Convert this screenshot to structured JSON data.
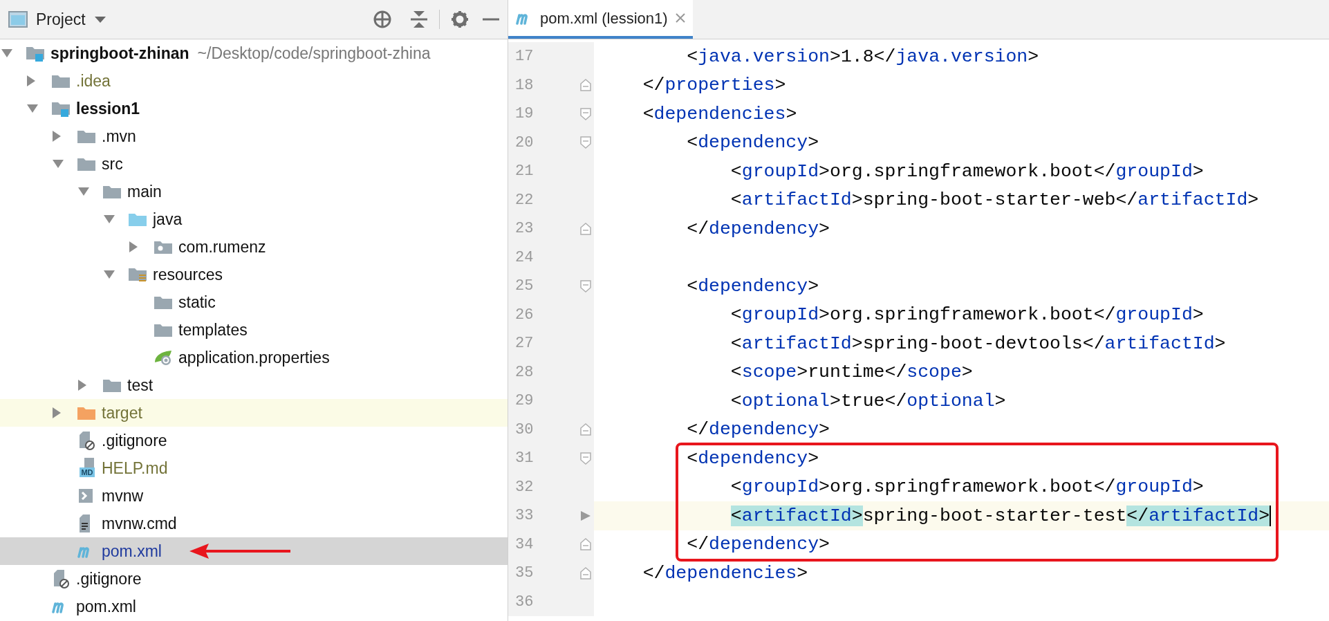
{
  "project_panel": {
    "title": "Project",
    "tree": [
      {
        "name": "springboot-zhinan",
        "path": "~/Desktop/code/springboot-zhina",
        "kind": "module",
        "expanded": true,
        "ignored": false,
        "modified": false,
        "selected": false,
        "highlighted": false,
        "arrow": false,
        "children": [
          {
            "name": ".idea",
            "kind": "folder",
            "expanded": false,
            "ignored": true,
            "modified": false,
            "selected": false,
            "highlighted": false,
            "arrow": false
          },
          {
            "name": "lession1",
            "kind": "module",
            "expanded": true,
            "ignored": false,
            "modified": false,
            "selected": false,
            "highlighted": false,
            "arrow": false,
            "children": [
              {
                "name": ".mvn",
                "kind": "folder",
                "expanded": false,
                "ignored": false,
                "modified": false,
                "selected": false,
                "highlighted": false,
                "arrow": false
              },
              {
                "name": "src",
                "kind": "folder",
                "expanded": true,
                "ignored": false,
                "modified": false,
                "selected": false,
                "highlighted": false,
                "arrow": false,
                "children": [
                  {
                    "name": "main",
                    "kind": "folder",
                    "expanded": true,
                    "ignored": false,
                    "modified": false,
                    "selected": false,
                    "highlighted": false,
                    "arrow": false,
                    "children": [
                      {
                        "name": "java",
                        "kind": "source-folder",
                        "expanded": true,
                        "ignored": false,
                        "modified": false,
                        "selected": false,
                        "highlighted": false,
                        "arrow": false,
                        "children": [
                          {
                            "name": "com.rumenz",
                            "kind": "package",
                            "expanded": false,
                            "ignored": false,
                            "modified": false,
                            "selected": false,
                            "highlighted": false,
                            "arrow": false
                          }
                        ]
                      },
                      {
                        "name": "resources",
                        "kind": "resources",
                        "expanded": true,
                        "ignored": false,
                        "modified": false,
                        "selected": false,
                        "highlighted": false,
                        "arrow": false,
                        "children": [
                          {
                            "name": "static",
                            "kind": "folder",
                            "ignored": false,
                            "modified": false,
                            "selected": false,
                            "highlighted": false,
                            "arrow": false
                          },
                          {
                            "name": "templates",
                            "kind": "folder",
                            "ignored": false,
                            "modified": false,
                            "selected": false,
                            "highlighted": false,
                            "arrow": false
                          },
                          {
                            "name": "application.properties",
                            "kind": "spring-properties",
                            "ignored": false,
                            "modified": false,
                            "selected": false,
                            "highlighted": false,
                            "arrow": false
                          }
                        ]
                      }
                    ]
                  },
                  {
                    "name": "test",
                    "kind": "folder",
                    "expanded": false,
                    "ignored": false,
                    "modified": false,
                    "selected": false,
                    "highlighted": false,
                    "arrow": false
                  }
                ]
              },
              {
                "name": "target",
                "kind": "excluded-folder",
                "expanded": false,
                "ignored": true,
                "modified": false,
                "selected": false,
                "highlighted": true,
                "arrow": false
              },
              {
                "name": ".gitignore",
                "kind": "gitignore",
                "ignored": false,
                "modified": false,
                "selected": false,
                "highlighted": false,
                "arrow": false
              },
              {
                "name": "HELP.md",
                "kind": "markdown",
                "icon_label": "MD",
                "ignored": true,
                "modified": false,
                "selected": false,
                "highlighted": false,
                "arrow": false
              },
              {
                "name": "mvnw",
                "kind": "script",
                "ignored": false,
                "modified": false,
                "selected": false,
                "highlighted": false,
                "arrow": false
              },
              {
                "name": "mvnw.cmd",
                "kind": "text-file",
                "ignored": false,
                "modified": false,
                "selected": false,
                "highlighted": false,
                "arrow": false
              },
              {
                "name": "pom.xml",
                "kind": "maven",
                "ignored": false,
                "modified": true,
                "selected": true,
                "highlighted": false,
                "arrow": true
              }
            ]
          },
          {
            "name": ".gitignore",
            "kind": "gitignore",
            "ignored": false,
            "modified": false,
            "selected": false,
            "highlighted": false,
            "arrow": false
          },
          {
            "name": "pom.xml",
            "kind": "maven",
            "ignored": false,
            "modified": false,
            "selected": false,
            "highlighted": false,
            "arrow": false
          }
        ]
      }
    ]
  },
  "editor": {
    "tab": {
      "title": "pom.xml (lession1)",
      "selected": true
    },
    "lines": [
      {
        "number": "17",
        "text": "        <java.version>1.8</java.version>",
        "kind": "plain",
        "current": false,
        "boxed": false
      },
      {
        "number": "18",
        "text": "    </properties>",
        "kind": "fold-end",
        "current": false,
        "boxed": false
      },
      {
        "number": "19",
        "text": "    <dependencies>",
        "kind": "fold-start",
        "current": false,
        "boxed": false
      },
      {
        "number": "20",
        "text": "        <dependency>",
        "kind": "fold-start",
        "current": false,
        "boxed": false
      },
      {
        "number": "21",
        "text": "            <groupId>org.springframework.boot</groupId>",
        "kind": "plain",
        "current": false,
        "boxed": false
      },
      {
        "number": "22",
        "text": "            <artifactId>spring-boot-starter-web</artifactId>",
        "kind": "plain",
        "current": false,
        "boxed": false
      },
      {
        "number": "23",
        "text": "        </dependency>",
        "kind": "fold-end",
        "current": false,
        "boxed": false
      },
      {
        "number": "24",
        "kind": "plain",
        "current": false,
        "boxed": false
      },
      {
        "number": "25",
        "text": "        <dependency>",
        "kind": "fold-start",
        "current": false,
        "boxed": false
      },
      {
        "number": "26",
        "text": "            <groupId>org.springframework.boot</groupId>",
        "kind": "plain",
        "current": false,
        "boxed": false
      },
      {
        "number": "27",
        "text": "            <artifactId>spring-boot-devtools</artifactId>",
        "kind": "plain",
        "current": false,
        "boxed": false
      },
      {
        "number": "28",
        "text": "            <scope>runtime</scope>",
        "kind": "plain",
        "current": false,
        "boxed": false
      },
      {
        "number": "29",
        "text": "            <optional>true</optional>",
        "kind": "plain",
        "current": false,
        "boxed": false
      },
      {
        "number": "30",
        "text": "        </dependency>",
        "kind": "fold-end",
        "current": false,
        "boxed": false
      },
      {
        "number": "31",
        "text": "        <dependency>",
        "kind": "fold-start",
        "current": false,
        "boxed": true
      },
      {
        "number": "32",
        "text": "            <groupId>org.springframework.boot</groupId>",
        "kind": "plain",
        "current": false,
        "boxed": true
      },
      {
        "number": "33",
        "text": "            <artifactId>spring-boot-starter-test</artifactId>",
        "kind": "plain",
        "current": true,
        "boxed": true
      },
      {
        "number": "34",
        "text": "        </dependency>",
        "kind": "fold-end",
        "current": false,
        "boxed": true
      },
      {
        "number": "35",
        "text": "    </dependencies>",
        "kind": "fold-end",
        "current": false,
        "boxed": false
      },
      {
        "number": "36",
        "kind": "plain",
        "current": false,
        "boxed": false
      }
    ]
  }
}
